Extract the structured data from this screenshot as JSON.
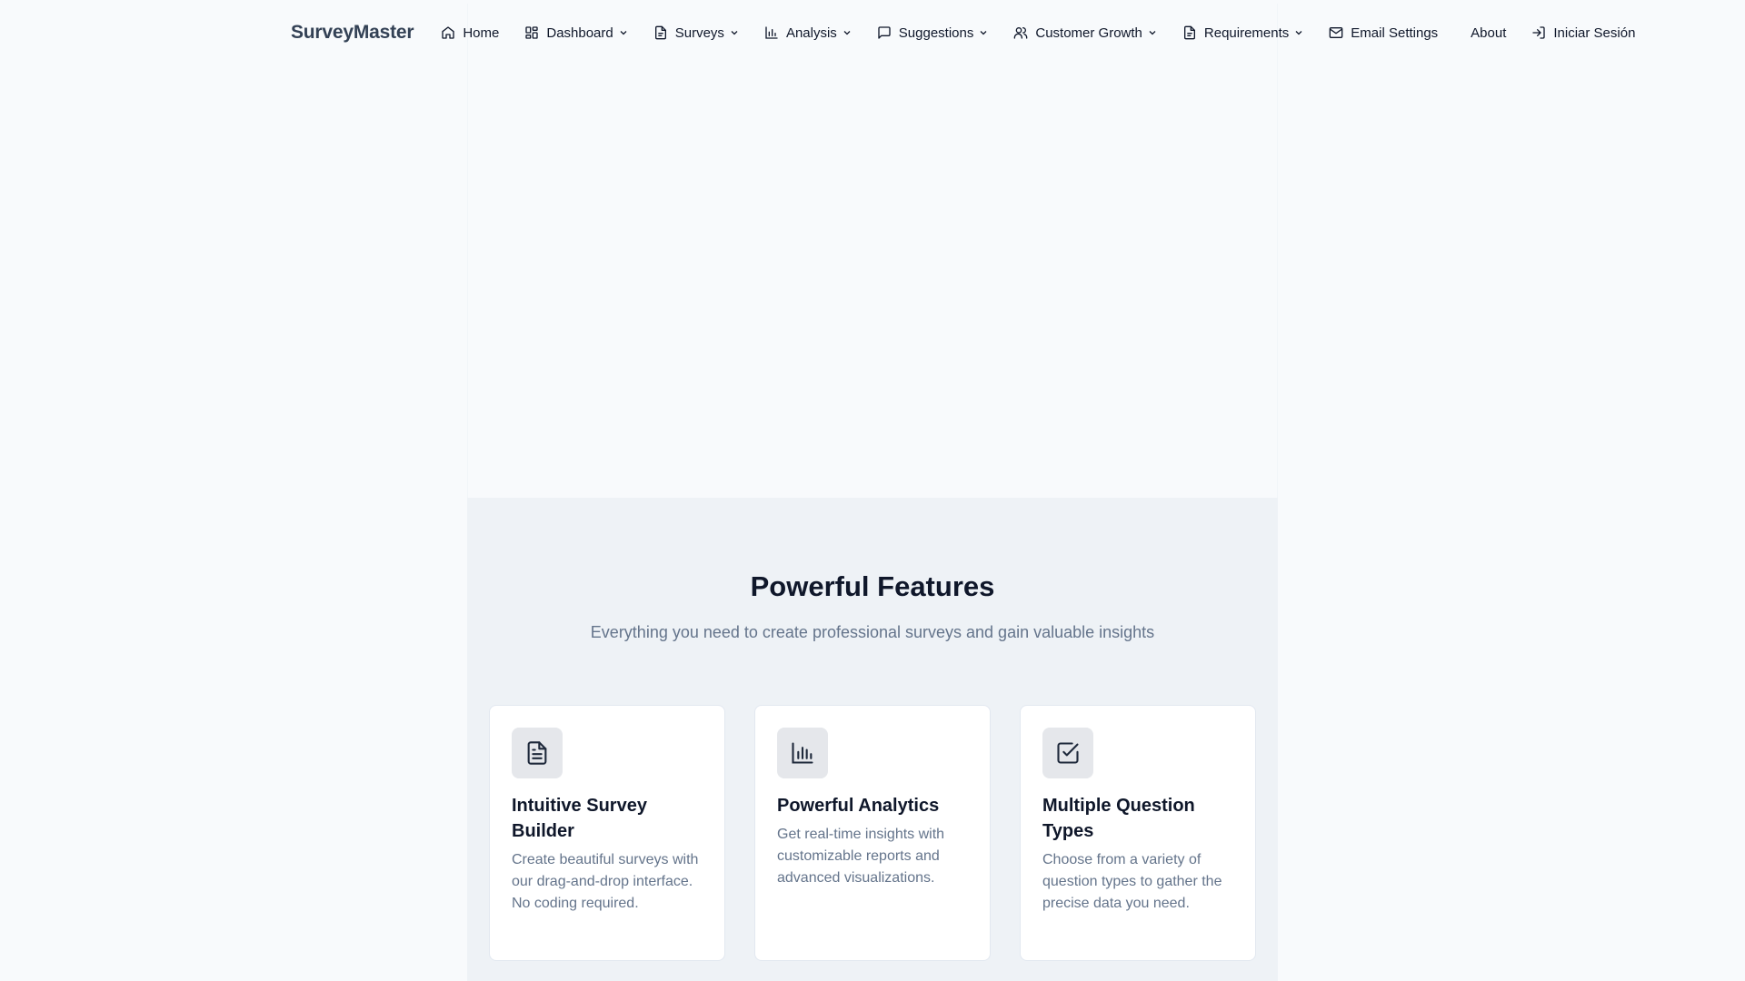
{
  "brand": "SurveyMaster",
  "nav": {
    "home": "Home",
    "dashboard": "Dashboard",
    "surveys": "Surveys",
    "analysis": "Analysis",
    "suggestions": "Suggestions",
    "customer_growth": "Customer Growth",
    "requirements": "Requirements",
    "email_settings": "Email Settings",
    "about": "About",
    "login": "Iniciar Sesión"
  },
  "features": {
    "title": "Powerful Features",
    "subtitle": "Everything you need to create professional surveys and gain valuable insights",
    "cards": [
      {
        "icon": "document-icon",
        "title": "Intuitive Survey Builder",
        "desc": "Create beautiful surveys with our drag-and-drop interface. No coding required."
      },
      {
        "icon": "bar-chart-icon",
        "title": "Powerful Analytics",
        "desc": "Get real-time insights with customizable reports and advanced visualizations."
      },
      {
        "icon": "check-square-icon",
        "title": "Multiple Question Types",
        "desc": "Choose from a variety of question types to gather the precise data you need."
      }
    ]
  },
  "colors": {
    "page_bg": "#f8fafc",
    "features_bg": "#eef2f6",
    "text": "#0f172a",
    "muted": "#64748b",
    "brand": "#334155"
  }
}
